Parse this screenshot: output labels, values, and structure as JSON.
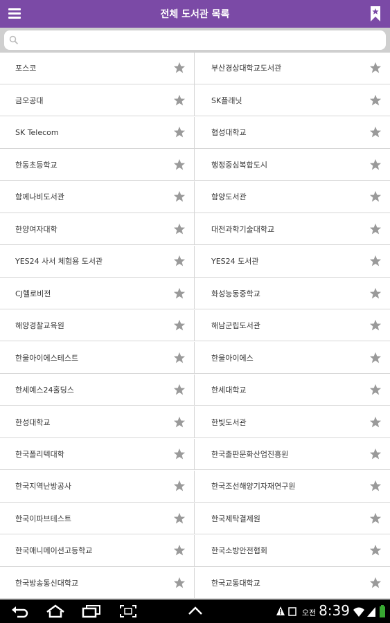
{
  "header": {
    "title": "전체 도서관 목록",
    "menu_icon": "hamburger-menu-icon",
    "bookmark_icon": "bookmark-icon"
  },
  "search": {
    "placeholder": "",
    "icon": "search-icon"
  },
  "libraries": {
    "left": [
      "포스코",
      "금오공대",
      "SK Telecom",
      "한동초등학교",
      "함께나비도서관",
      "한양여자대학",
      "YES24 사서 체험용 도서관",
      "CJ헬로비전",
      "해양경찰교육원",
      "한울아이에스테스트",
      "한세예스24홀딩스",
      "한성대학교",
      "한국폴리텍대학",
      "한국지역난방공사",
      "한국이파브테스트",
      "한국애니메이션고등학교",
      "한국방송통신대학교"
    ],
    "right": [
      "부산경상대학교도서관",
      "SK플래닛",
      "협성대학교",
      "행정중심복합도시",
      "함양도서관",
      "대전과학기술대학교",
      "YES24 도서관",
      "화성능동중학교",
      "해남군립도서관",
      "한울아이에스",
      "한세대학교",
      "한빛도서관",
      "한국출판문화산업진흥원",
      "한국조선해양기자재연구원",
      "한국제탁결제원",
      "한국소방안전협회",
      "한국교통대학교"
    ]
  },
  "status_bar": {
    "ampm": "오전",
    "time": "8:39"
  },
  "colors": {
    "appbar": "#7b4aa6",
    "star": "#9a9a9a",
    "divider": "#d6d6d6"
  }
}
